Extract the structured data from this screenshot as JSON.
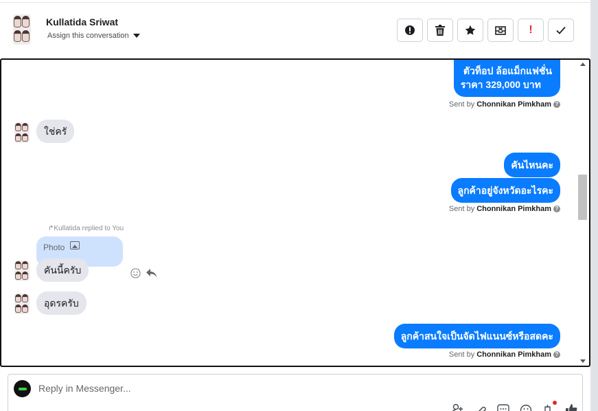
{
  "header": {
    "contact_name": "Kullatida Sriwat",
    "assign_label": "Assign this conversation",
    "toolbar": [
      {
        "name": "report-spam-button",
        "icon": "exclamation-circle-icon"
      },
      {
        "name": "delete-button",
        "icon": "trash-icon"
      },
      {
        "name": "star-button",
        "icon": "star-icon"
      },
      {
        "name": "archive-button",
        "icon": "envelope-x-icon"
      },
      {
        "name": "important-button",
        "icon": "exclamation-mark-icon",
        "label": "!"
      },
      {
        "name": "done-button",
        "icon": "checkmark-icon"
      }
    ]
  },
  "conversation": {
    "messages": [
      {
        "side": "out",
        "lines": [
          "ตัวท็อป ล้อแม็กแฟชั่น",
          "ราคา 329,000 บาท"
        ]
      },
      {
        "side": "sent_by",
        "prefix": "Sent by",
        "agent": "Chonnikan Pimkham"
      },
      {
        "side": "in",
        "text": "ใช่ครั"
      },
      {
        "side": "out",
        "text": "คันไหนคะ"
      },
      {
        "side": "out",
        "text": "ลูกค้าอยู่จังหวัดอะไรคะ"
      },
      {
        "side": "sent_by",
        "prefix": "Sent by",
        "agent": "Chonnikan Pimkham"
      },
      {
        "side": "reply_note",
        "text": "Kullatida replied to You"
      },
      {
        "side": "reply_quote",
        "text": "Photo"
      },
      {
        "side": "in",
        "text": "คันนี้ครับ"
      },
      {
        "side": "in",
        "text": "อุดรครับ"
      },
      {
        "side": "out",
        "text": "ลูกค้าสนใจเป็นจัดไฟแนนซ์หรือสดคะ"
      },
      {
        "side": "sent_by",
        "prefix": "Sent by",
        "agent": "Chonnikan Pimkham"
      }
    ]
  },
  "composer": {
    "placeholder": "Reply in Messenger...",
    "icons": [
      "add-contact-icon",
      "paperclip-icon",
      "saved-reply-icon",
      "emoji-icon",
      "tag-icon",
      "thumbs-up-icon"
    ]
  },
  "colors": {
    "outgoing_bubble": "#0a7cff",
    "incoming_bubble": "#e4e6eb",
    "reply_quote_bubble": "#cfe2fd",
    "important": "#e4252c"
  }
}
